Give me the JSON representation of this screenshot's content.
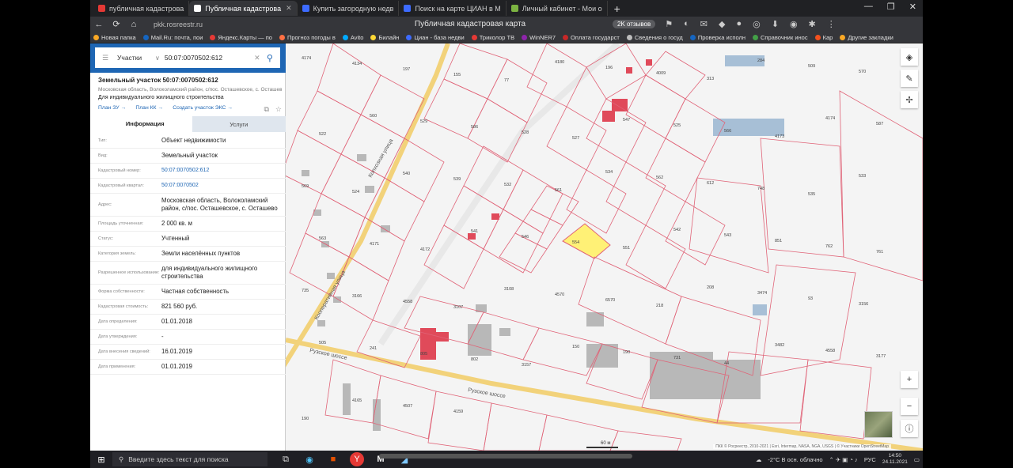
{
  "browser": {
    "tabs": [
      {
        "label": "публичная кадастрова",
        "color": "#e53935",
        "active": false
      },
      {
        "label": "Публичная кадастрова",
        "color": "#ffffff",
        "active": true
      },
      {
        "label": "Купить загородную недв",
        "color": "#3d6bff",
        "active": false
      },
      {
        "label": "Поиск на карте ЦИАН в М",
        "color": "#3d6bff",
        "active": false
      },
      {
        "label": "Личный кабинет - Мои о",
        "color": "#7cb342",
        "active": false
      }
    ],
    "newtab_label": "+",
    "url": "pkk.rosreestr.ru",
    "page_title": "Публичная кадастровая карта",
    "reviews_badge": "2K отзывов"
  },
  "bookmarks": [
    {
      "label": "Новая папка",
      "color": "#f9a825"
    },
    {
      "label": "Mail.Ru: почта, пои",
      "color": "#1565c0"
    },
    {
      "label": "Яндекс.Карты — по",
      "color": "#e53935"
    },
    {
      "label": "Прогноз погоды в",
      "color": "#ff7043"
    },
    {
      "label": "Avito",
      "color": "#00aaff"
    },
    {
      "label": "Билайн",
      "color": "#fdd835"
    },
    {
      "label": "Циан - база недви",
      "color": "#3d6bff"
    },
    {
      "label": "Триколор ТВ",
      "color": "#e53935"
    },
    {
      "label": "WinNER7",
      "color": "#8e24aa"
    },
    {
      "label": "Оплата государст",
      "color": "#c62828"
    },
    {
      "label": "Сведения о госуд",
      "color": "#bdbdbd"
    },
    {
      "label": "Проверка исполн",
      "color": "#1565c0"
    },
    {
      "label": "Справочник инос",
      "color": "#43a047"
    },
    {
      "label": "Кар",
      "color": "#f4511e"
    },
    {
      "label": "Другие закладки",
      "color": "#f9a825"
    }
  ],
  "search": {
    "type_label": "Участки",
    "value": "50:07:0070502:612"
  },
  "object": {
    "title": "Земельный участок 50:07:0070502:612",
    "address": "Московская область, Волоколамский район, с/пос. Осташевское, с. Осташево",
    "use": "Для индивидуального жилищного строительства",
    "links": [
      "План ЗУ →",
      "План КК →",
      "Создать участок ЭКС →"
    ]
  },
  "tabs": {
    "info": "Информация",
    "services": "Услуги"
  },
  "properties": [
    {
      "key": "Тип:",
      "value": "Объект недвижимости",
      "link": false
    },
    {
      "key": "Вид:",
      "value": "Земельный участок",
      "link": false
    },
    {
      "key": "Кадастровый номер:",
      "value": "50:07:0070502:612",
      "link": true
    },
    {
      "key": "Кадастровый квартал:",
      "value": "50:07:0070502",
      "link": true
    },
    {
      "key": "Адрес:",
      "value": "Московская область, Волоколамский район, с/пос. Осташевское, с. Осташево",
      "link": false
    },
    {
      "key": "Площадь уточненная:",
      "value": "2 000 кв. м",
      "link": false
    },
    {
      "key": "Статус:",
      "value": "Учтенный",
      "link": false
    },
    {
      "key": "Категория земель:",
      "value": "Земли населённых пунктов",
      "link": false
    },
    {
      "key": "Разрешенное использование:",
      "value": "для индивидуального жилищного строительства",
      "link": false
    },
    {
      "key": "Форма собственности:",
      "value": "Частная собственность",
      "link": false
    },
    {
      "key": "Кадастровая стоимость:",
      "value": "821 560 руб.",
      "link": false
    },
    {
      "key": "Дата определения:",
      "value": "01.01.2018",
      "link": false
    },
    {
      "key": "Дата утверждения:",
      "value": "-",
      "link": false
    },
    {
      "key": "Дата внесения сведений:",
      "value": "16.01.2019",
      "link": false
    },
    {
      "key": "Дата применения:",
      "value": "01.01.2019",
      "link": false
    }
  ],
  "map": {
    "streets": [
      "Колхозная улица",
      "Кооперативная улица",
      "Рузское шоссе",
      "Рузское шоссе"
    ],
    "parcel_labels": [
      "4174",
      "4134",
      "197",
      "155",
      "77",
      "4180",
      "196",
      "4009",
      "313",
      "284",
      "509",
      "570",
      "522",
      "560",
      "529",
      "586",
      "528",
      "527",
      "547",
      "525",
      "566",
      "4173",
      "4174",
      "587",
      "569",
      "524",
      "540",
      "539",
      "532",
      "561",
      "534",
      "562",
      "612",
      "748",
      "535",
      "533",
      "563",
      "4171",
      "4172",
      "541",
      "546",
      "554",
      "551",
      "542",
      "543",
      "851",
      "762",
      "761",
      "735",
      "3166",
      "4558",
      "3107",
      "3108",
      "4570",
      "6570",
      "218",
      "208",
      "3474",
      "93",
      "3156",
      "505",
      "241",
      "805",
      "802",
      "3157",
      "150",
      "190",
      "731",
      "44",
      "3482",
      "4558",
      "3177",
      "190",
      "4165",
      "4507",
      "4159"
    ],
    "scale_label": "60 м",
    "attribution": "ПКК © Росреестр, 2010-2021 | Esri, Intermap, NASA, NGA, USGS | © Участники OpenStreetMap",
    "selected_color": "#fff176",
    "line_color": "#e06377"
  },
  "taskbar": {
    "search_placeholder": "Введите здесь текст для поиска",
    "weather": "-2°C  В осн. облачно",
    "lang": "РУС",
    "time": "14:50",
    "date": "24.11.2021"
  }
}
